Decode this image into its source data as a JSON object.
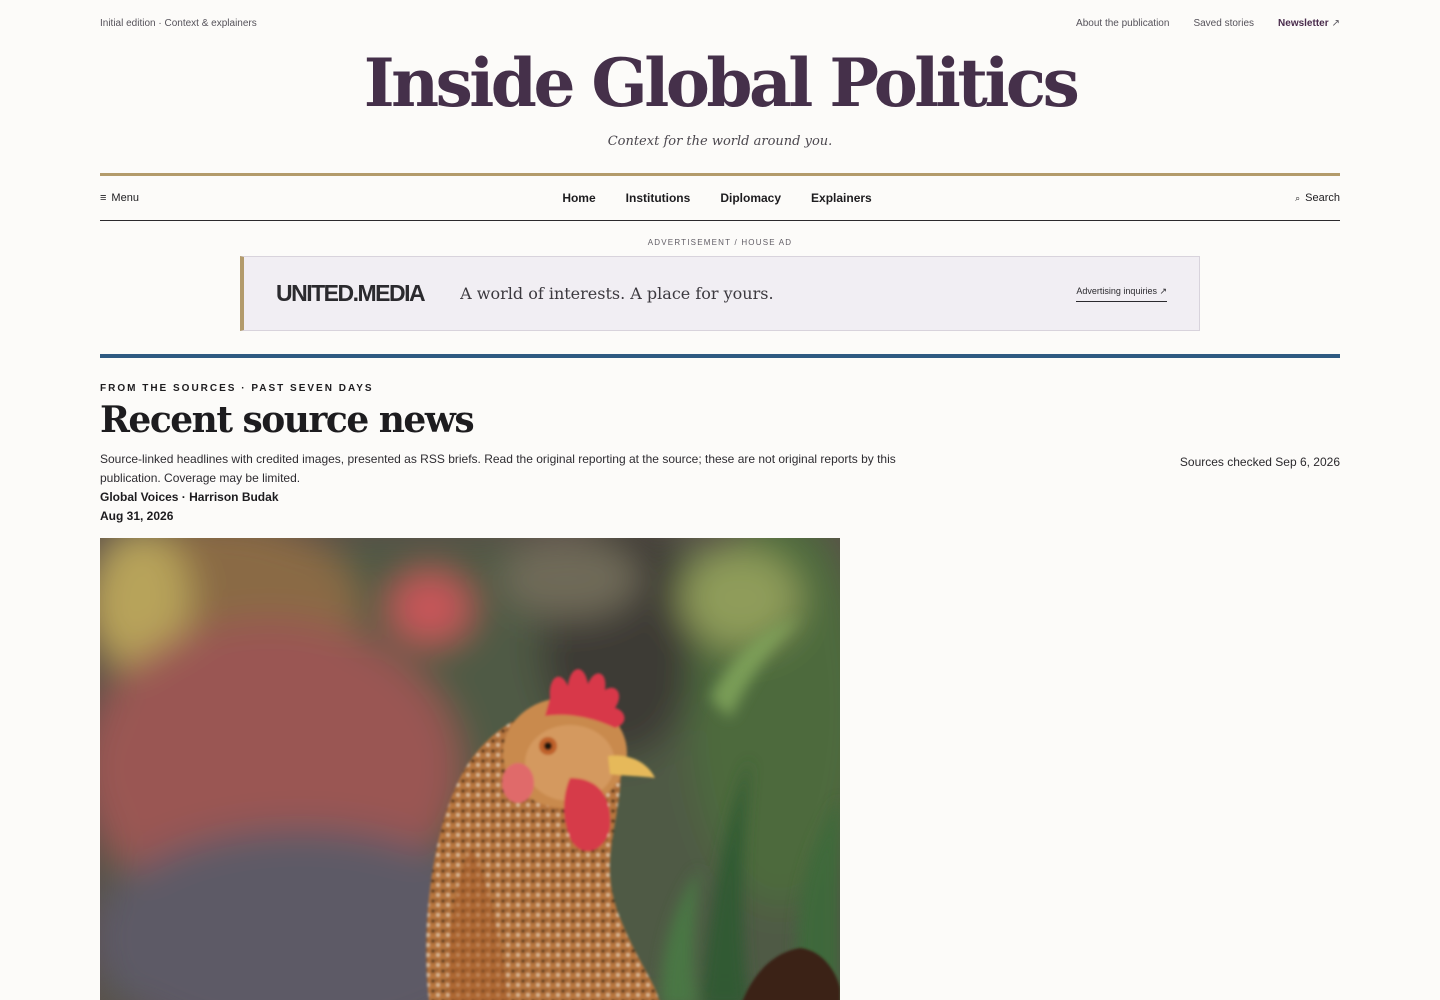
{
  "utility": {
    "edition": "Initial edition · Context & explainers",
    "about": "About the publication",
    "saved": "Saved stories",
    "newsletter": "Newsletter",
    "newsletter_arrow": "↗"
  },
  "masthead": {
    "title": "Inside Global Politics",
    "tagline": "Context for the world around you."
  },
  "nav": {
    "menu_icon": "≡",
    "menu_label": "Menu",
    "links": [
      "Home",
      "Institutions",
      "Diplomacy",
      "Explainers"
    ],
    "search_icon": "⌕",
    "search_label": "Search"
  },
  "ad": {
    "label": "ADVERTISEMENT / HOUSE AD",
    "logo": "UNITED.MEDIA",
    "tagline": "A world of interests. A place for yours.",
    "cta": "Advertising inquiries ↗"
  },
  "section": {
    "kicker": "FROM THE SOURCES · PAST SEVEN DAYS",
    "title": "Recent source news",
    "checked": "Sources checked Sep 6, 2026",
    "description": "Source-linked headlines with credited images, presented as RSS briefs. Read the original reporting at the source; these are not original reports by this publication. Coverage may be limited.",
    "byline": "Global Voices · Harrison Budak",
    "date": "Aug 31, 2026"
  },
  "colors": {
    "brand": "#45304a",
    "rule_gold": "#b39b6b",
    "rule_blue": "#2e5a82",
    "background": "#fcfbf9"
  },
  "photo": {
    "subject": "rooster-photo"
  }
}
